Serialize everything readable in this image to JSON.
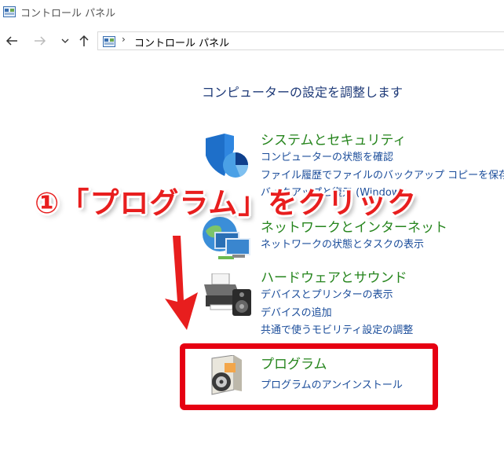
{
  "window": {
    "title": "コントロール パネル"
  },
  "address": {
    "separator": "›",
    "path": "コントロール パネル"
  },
  "heading": "コンピューターの設定を調整します",
  "categories": [
    {
      "title": "システムとセキュリティ",
      "links": [
        "コンピューターの状態を確認",
        "ファイル履歴でファイルのバックアップ コピーを保存",
        "バックアップと復元 (Windows"
      ]
    },
    {
      "title": "ネットワークとインターネット",
      "links": [
        "ネットワークの状態とタスクの表示"
      ]
    },
    {
      "title": "ハードウェアとサウンド",
      "links": [
        "デバイスとプリンターの表示",
        "デバイスの追加",
        "共通で使うモビリティ設定の調整"
      ]
    },
    {
      "title": "プログラム",
      "links": [
        "プログラムのアンインストール"
      ]
    }
  ],
  "annotation": {
    "text": "①「プログラム」をクリック"
  },
  "colors": {
    "category_title": "#26851d",
    "link": "#1a4c9a",
    "heading": "#1e3a78",
    "annotation": "#e81e1e",
    "highlight_box": "#e60012"
  },
  "icons": {
    "title": "control-panel-icon",
    "back": "back-arrow-icon",
    "forward": "forward-arrow-icon",
    "recent": "chevron-down-icon",
    "up": "up-arrow-icon"
  }
}
